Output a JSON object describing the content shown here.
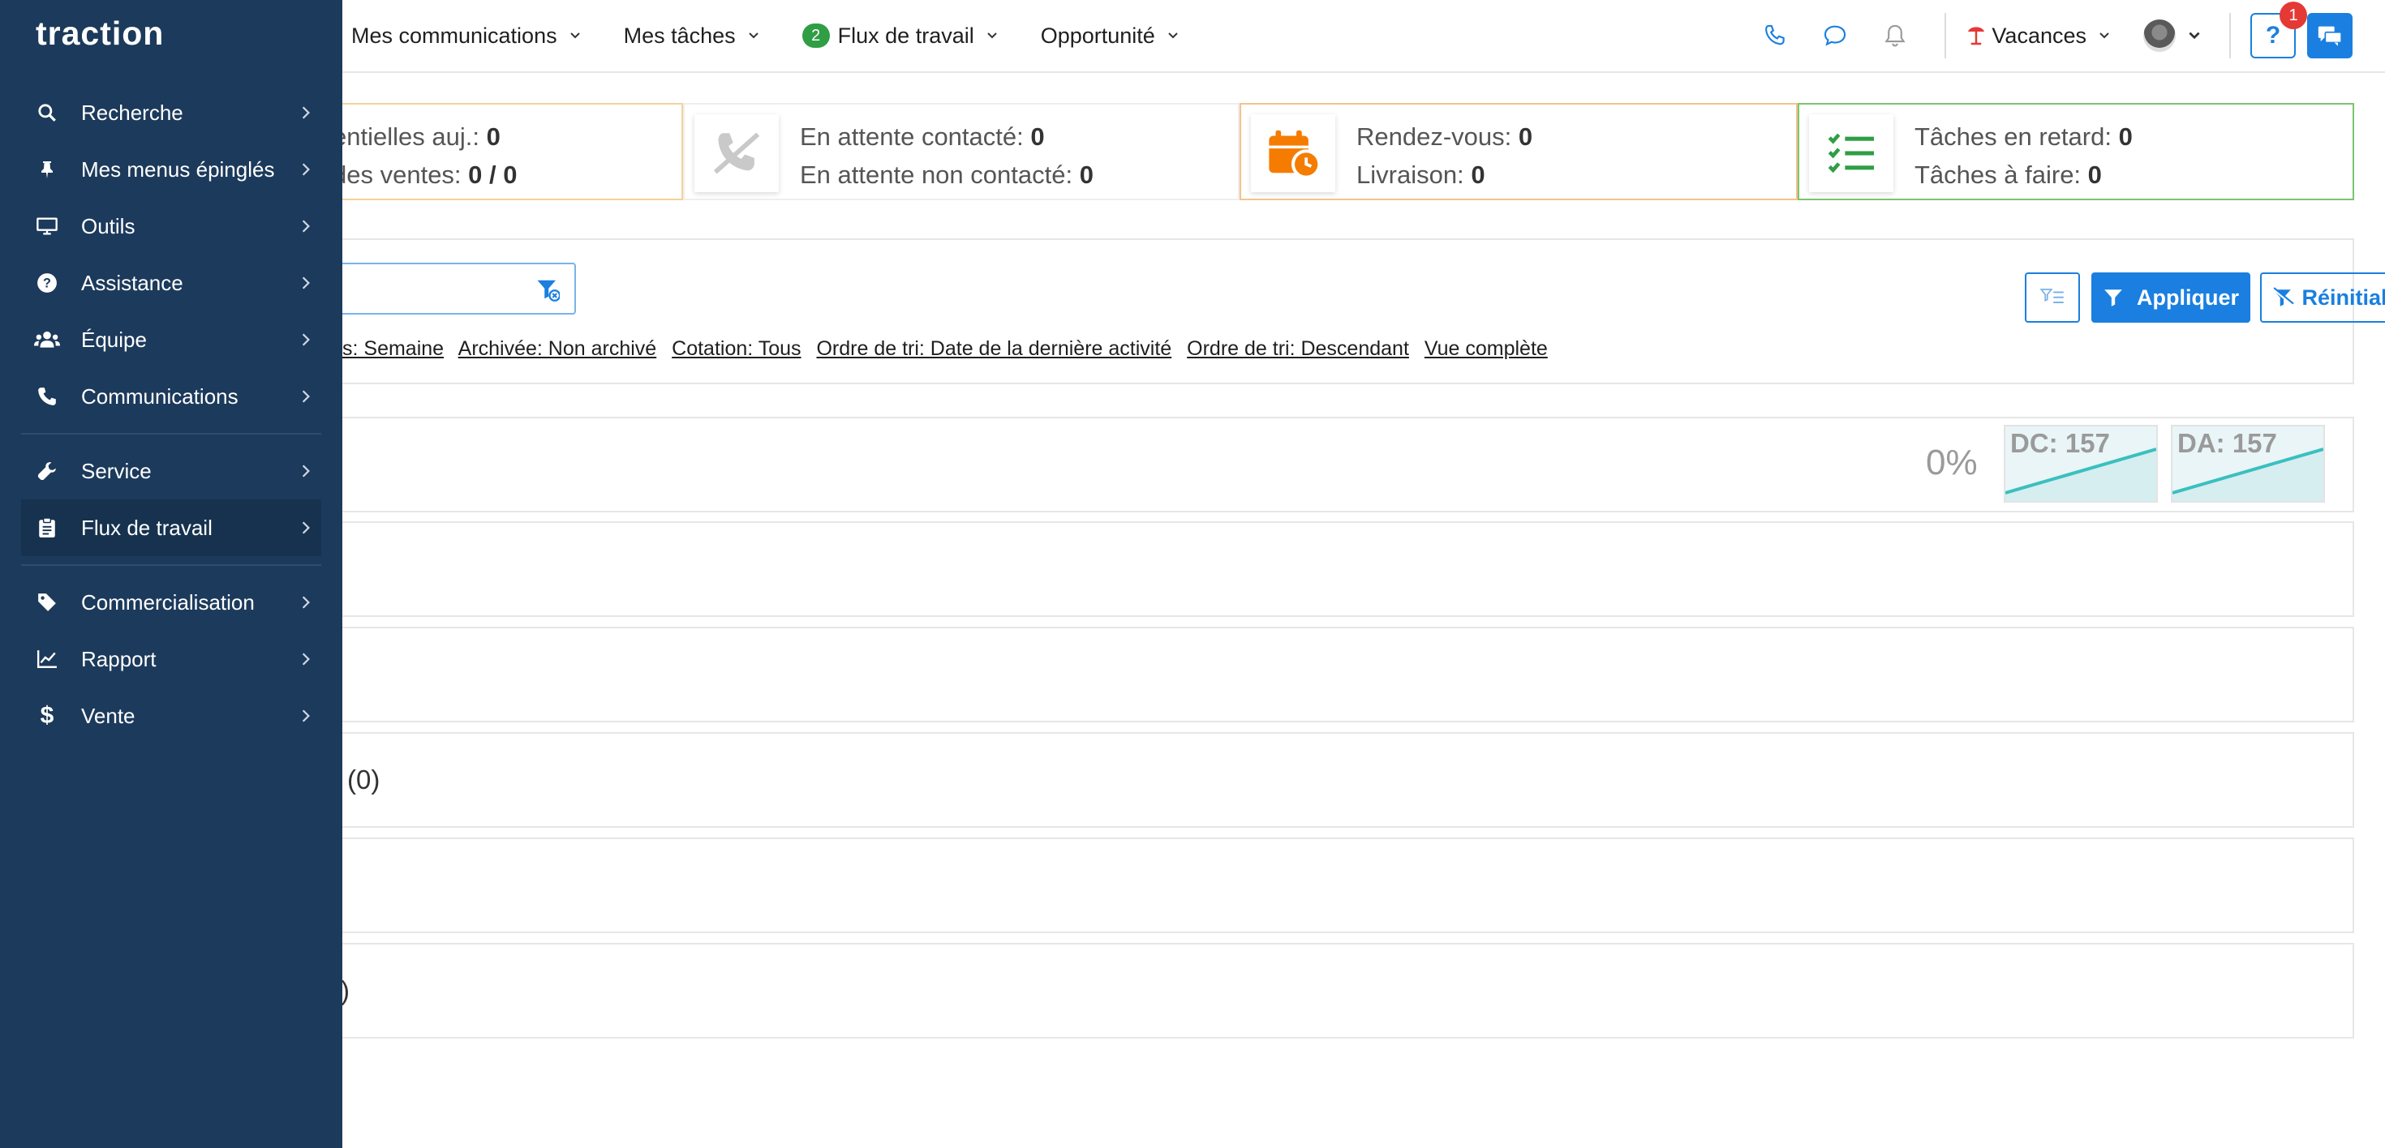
{
  "app": {
    "logo": "traction"
  },
  "colors": {
    "sidebar": "#1c3a5b",
    "primary": "#1a7fe0",
    "accent_orange": "#f57c00",
    "accent_green": "#2f9e44",
    "alert_red": "#e53935"
  },
  "topnav": {
    "items": [
      {
        "label": "Mes communications"
      },
      {
        "label": "Mes tâches"
      },
      {
        "label": "Flux de travail",
        "badge": "2"
      },
      {
        "label": "Opportunité"
      }
    ],
    "status": "Vacances",
    "help_badge": "1"
  },
  "sidebar": {
    "items": [
      {
        "label": "Recherche",
        "icon": "search-icon"
      },
      {
        "label": "Mes menus épinglés",
        "icon": "pin-icon"
      },
      {
        "label": "Outils",
        "icon": "monitor-icon"
      },
      {
        "label": "Assistance",
        "icon": "question-circle-icon"
      },
      {
        "label": "Équipe",
        "icon": "users-icon"
      },
      {
        "label": "Communications",
        "icon": "phone-icon"
      },
      {
        "label": "Service",
        "icon": "wrench-icon"
      },
      {
        "label": "Flux de travail",
        "icon": "clipboard-icon",
        "active": true
      },
      {
        "label": "Commercialisation",
        "icon": "tag-icon"
      },
      {
        "label": "Rapport",
        "icon": "line-chart-icon"
      },
      {
        "label": "Vente",
        "icon": "dollar-icon"
      }
    ]
  },
  "stats": {
    "card1": {
      "line1_label": "entielles auj.:",
      "line1_value": "0",
      "line2_label": "des ventes:",
      "line2_value": "0 / 0"
    },
    "card2": {
      "line1_label": "En attente contacté:",
      "line1_value": "0",
      "line2_label": "En attente non contacté:",
      "line2_value": "0"
    },
    "card3": {
      "line1_label": "Rendez-vous:",
      "line1_value": "0",
      "line2_label": "Livraison:",
      "line2_value": "0"
    },
    "card4": {
      "line1_label": "Tâches en retard:",
      "line1_value": "0",
      "line2_label": "Tâches à faire:",
      "line2_value": "0"
    }
  },
  "filters": {
    "chips": [
      "s: Semaine",
      "Archivée: Non archivé",
      "Cotation: Tous",
      "Ordre de tri: Date de la dernière activité",
      "Ordre de tri: Descendant",
      "Vue complète"
    ],
    "apply_label": "Appliquer",
    "reset_label": "Réinitialiser"
  },
  "summary": {
    "percent": "0%",
    "dc_label": "DC: 157",
    "da_label": "DA: 157"
  },
  "rows": {
    "row3_label": "(0)",
    "row5_label": ")"
  }
}
